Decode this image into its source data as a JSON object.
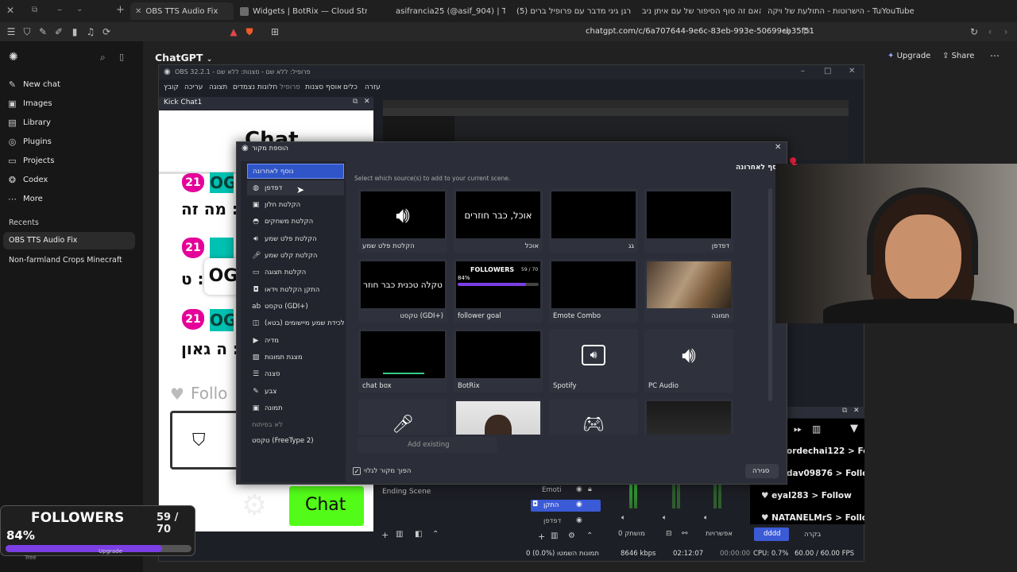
{
  "browser": {
    "tabs": [
      {
        "label": "OBS TTS Audio Fix",
        "active": true
      },
      {
        "label": "Widgets | BotRix — Cloud Streaming"
      },
      {
        "label": "asifrancia25 (@asif_904) | TikTok"
      },
      {
        "label": "(5) רגן גיגי מדבר עם פרופיל ברים"
      },
      {
        "label": "האם זה סוף הסיפור של עם איתן ניב"
      },
      {
        "label": "הישרוטות - התולעת של ויקה - Tube"
      },
      {
        "label": "YouTube"
      }
    ],
    "url": "chatgpt.com/c/6a707644-9e6c-83eb-993e-50699cb35f51"
  },
  "chatgpt": {
    "title": "ChatGPT",
    "upgrade": "Upgrade",
    "share": "Share",
    "nav": [
      {
        "label": "New chat",
        "icon": "edit-icon"
      },
      {
        "label": "Images",
        "icon": "image-icon"
      },
      {
        "label": "Library",
        "icon": "library-icon"
      },
      {
        "label": "Plugins",
        "icon": "plugin-icon"
      },
      {
        "label": "Projects",
        "icon": "folder-icon"
      },
      {
        "label": "Codex",
        "icon": "codex-icon"
      },
      {
        "label": "More",
        "icon": "more-icon"
      }
    ],
    "recents_label": "Recents",
    "recents": [
      "OBS TTS Audio Fix",
      "Non-farmland Crops Minecraft"
    ]
  },
  "obs": {
    "title": "OBS 32.2.1 - פרופיל: ללא שם - סצנות: ללא שם",
    "menu": [
      "קובץ",
      "עריכה",
      "תצוגה",
      "חלונות נצמדים",
      "פרופיל",
      "אוסף סצנות",
      "כלים",
      "עזרה"
    ],
    "kick_dock_title": "Kick Chat1",
    "chat_word": "Chat",
    "chat_lines": [
      "מה זה :",
      "ט :",
      "ה גאון :"
    ],
    "badge_num": "21",
    "og_label": "OG",
    "follow_text": "Follo",
    "ending_scene": "Ending Scene",
    "mixer_items": [
      "Emoti",
      "התקן",
      "דפדפן"
    ],
    "chat_events": [
      {
        "user": "ordechai122",
        "action": "> Follo"
      },
      {
        "user": "dav09876",
        "action": "> Follow"
      },
      {
        "user": "eyal283",
        "action": "> Follow"
      },
      {
        "user": "NATANELMrS",
        "action": "> Follo"
      }
    ],
    "bottom_buttons": {
      "dddd": "dddd",
      "control": "בקרה",
      "settings": "אפשרויות",
      "muted": "0 מושתק"
    },
    "status": {
      "frames": "0 (0.0%) תמונות השמטו",
      "kbps": "8646 kbps",
      "time": "02:12:07",
      "rec": "00:00:00",
      "cpu": "CPU: 0.7%",
      "fps": "60.00 / 60.00 FPS"
    }
  },
  "dialog": {
    "title": "הוספת מקור",
    "header": "נוסף לאחרונה",
    "subtitle": "Select which source(s) to add to your current scene.",
    "sources": [
      {
        "label": "נוסף לאחרונה",
        "icon": "",
        "selected": true
      },
      {
        "label": "דפדפן",
        "icon": "globe-icon"
      },
      {
        "label": "הקלטת חלון",
        "icon": "window-icon"
      },
      {
        "label": "הקלטת משחקים",
        "icon": "gamepad-icon"
      },
      {
        "label": "הקלטת פלט שמע",
        "icon": "speaker-icon"
      },
      {
        "label": "הקלטת קלט שמע",
        "icon": "mic-icon"
      },
      {
        "label": "הקלטת תצוגה",
        "icon": "monitor-icon"
      },
      {
        "label": "התקן הקלטת וידאו",
        "icon": "camera-icon"
      },
      {
        "label": "טקסט (GDI+)",
        "icon": "text-icon"
      },
      {
        "label": "לכידת שמע מיישומים (בטא)",
        "icon": "app-audio-icon"
      },
      {
        "label": "מדיה",
        "icon": "play-icon"
      },
      {
        "label": "מצגת תמונות",
        "icon": "slideshow-icon"
      },
      {
        "label": "סצנה",
        "icon": "list-icon"
      },
      {
        "label": "צבע",
        "icon": "brush-icon"
      },
      {
        "label": "תמונה",
        "icon": "image-icon"
      }
    ],
    "deprecated_label": "לא בפיתוח",
    "deprecated": [
      {
        "label": "טקסט (FreeType 2)"
      }
    ],
    "cards": [
      {
        "label": "הקלטת פלט שמע",
        "preview": "speaker"
      },
      {
        "label": "אוכל",
        "preview": "text",
        "text": "אוכל, כבר חוזרים"
      },
      {
        "label": "גג",
        "preview": "black"
      },
      {
        "label": "דפדפן",
        "preview": "black"
      },
      {
        "label": "טקסט (GDI+)",
        "preview": "text",
        "text": "טקלה טכנית כבר חוזר"
      },
      {
        "label": "follower goal",
        "preview": "followers"
      },
      {
        "label": "Emote Combo",
        "preview": "black"
      },
      {
        "label": "תמונה",
        "preview": "photo"
      },
      {
        "label": "chat box",
        "preview": "chatbox"
      },
      {
        "label": "BotRix",
        "preview": "black"
      },
      {
        "label": "Spotify",
        "preview": "spotify"
      },
      {
        "label": "PC Audio",
        "preview": "speaker"
      },
      {
        "label": "",
        "preview": "mic"
      },
      {
        "label": "",
        "preview": "person"
      },
      {
        "label": "",
        "preview": "gamepad"
      },
      {
        "label": "",
        "preview": "screen"
      }
    ],
    "add_existing": "Add existing",
    "checkbox_label": "הפוך מקור לגלוי",
    "close_button": "סגירה"
  },
  "followers_overlay": {
    "title": "FOLLOWERS",
    "count": "59 / 70",
    "percent": "84%",
    "progress": 0.84,
    "upgrade": "Upgrade",
    "tree": "Tree"
  }
}
